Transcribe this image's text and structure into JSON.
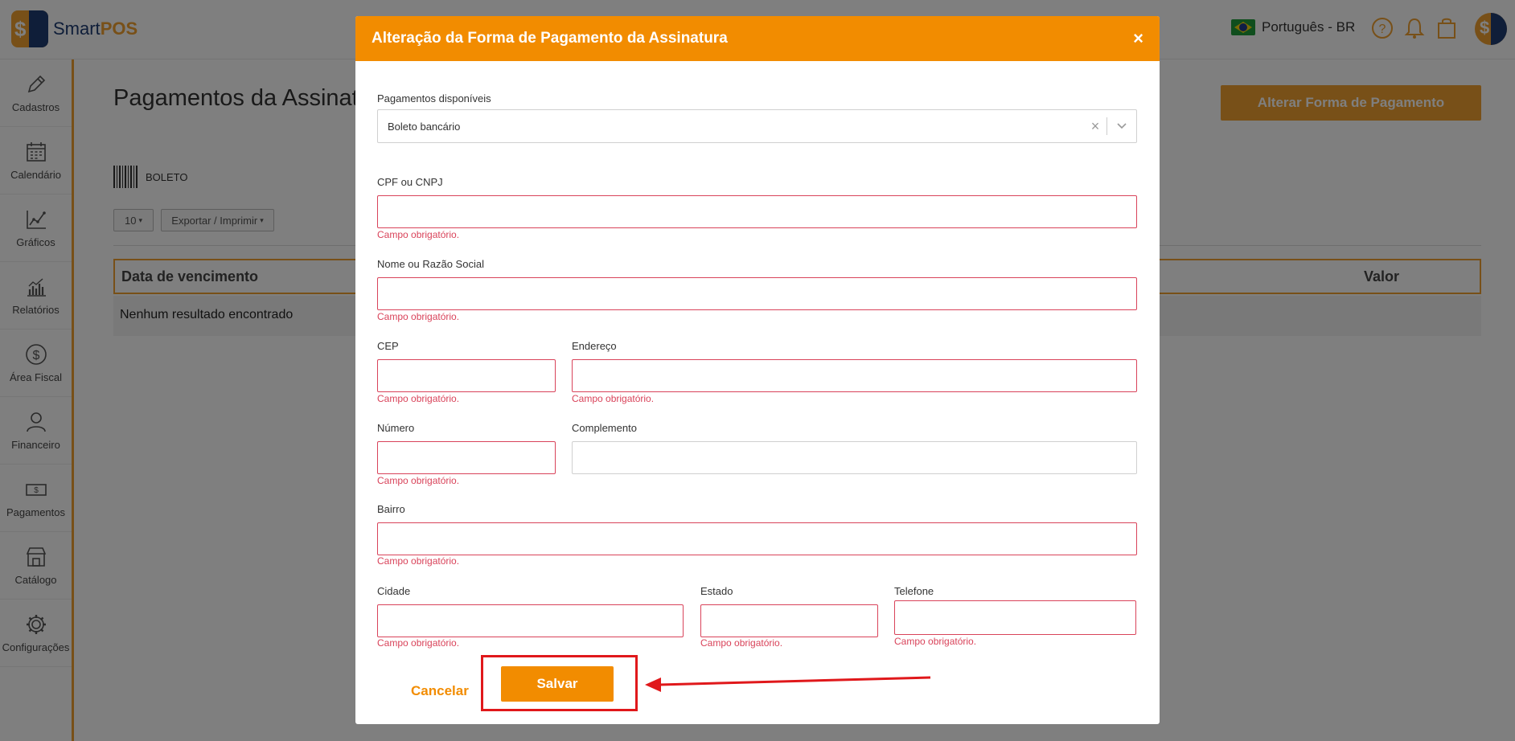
{
  "app": {
    "logo_prefix": "Smart",
    "logo_suffix": "POS"
  },
  "topbar": {
    "language": "Português - BR"
  },
  "sidebar": {
    "items": [
      {
        "label": "Cadastros",
        "icon": "pencil-icon"
      },
      {
        "label": "Calendário",
        "icon": "calendar-icon"
      },
      {
        "label": "Gráficos",
        "icon": "line-chart-icon"
      },
      {
        "label": "Relatórios",
        "icon": "bar-chart-icon"
      },
      {
        "label": "Área Fiscal",
        "icon": "dollar-circle-icon"
      },
      {
        "label": "Financeiro",
        "icon": "person-icon"
      },
      {
        "label": "Pagamentos",
        "icon": "banknote-icon"
      },
      {
        "label": "Catálogo",
        "icon": "store-icon"
      },
      {
        "label": "Configurações",
        "icon": "gear-icon"
      }
    ]
  },
  "page": {
    "title": "Pagamentos da Assinatura",
    "change_button": "Alterar Forma de Pagamento",
    "method": "BOLETO",
    "page_size": "10",
    "export_label": "Exportar / Imprimir",
    "columns": {
      "due_date": "Data de vencimento",
      "value": "Valor"
    },
    "empty_message": "Nenhum resultado encontrado"
  },
  "modal": {
    "title": "Alteração da Forma de Pagamento da Assinatura",
    "close": "×",
    "payment_label": "Pagamentos disponíveis",
    "payment_value": "Boleto bancário",
    "required_error": "Campo obrigatório.",
    "fields": {
      "cpf": "CPF ou CNPJ",
      "name": "Nome ou Razão Social",
      "cep": "CEP",
      "address": "Endereço",
      "number": "Número",
      "complement": "Complemento",
      "district": "Bairro",
      "city": "Cidade",
      "state": "Estado",
      "phone": "Telefone"
    },
    "cancel": "Cancelar",
    "save": "Salvar"
  },
  "colors": {
    "accent": "#f28c00",
    "error": "#d9435a",
    "annotation": "#e0181b",
    "brand_dark": "#1e3c72"
  }
}
